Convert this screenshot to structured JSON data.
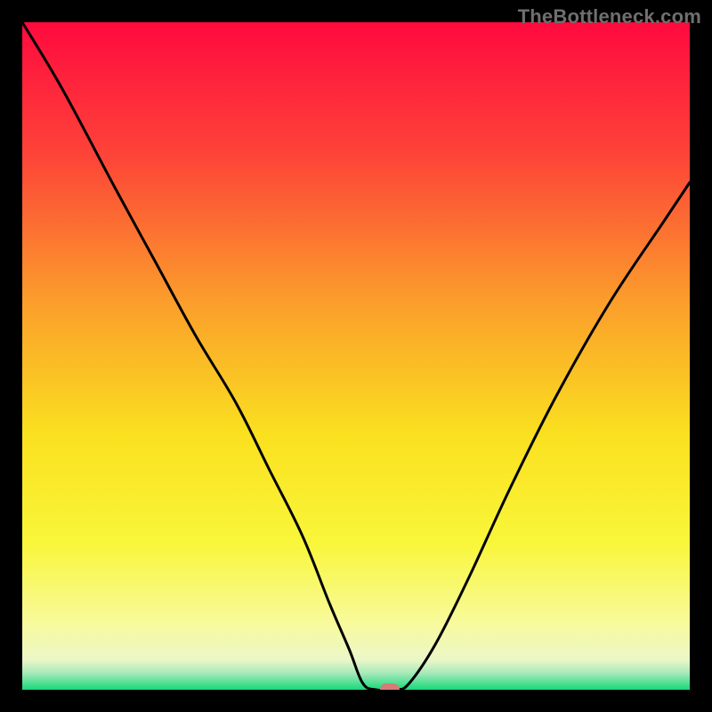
{
  "watermark": "TheBottleneck.com",
  "chart_data": {
    "type": "line",
    "title": "",
    "xlabel": "",
    "ylabel": "",
    "xlim": [
      0,
      100
    ],
    "ylim": [
      0,
      100
    ],
    "grid": false,
    "legend": false,
    "background_gradient": [
      {
        "pos": 0.0,
        "color": "#ff0a3f"
      },
      {
        "pos": 0.2,
        "color": "#fd4438"
      },
      {
        "pos": 0.42,
        "color": "#fb9e2b"
      },
      {
        "pos": 0.62,
        "color": "#fae11f"
      },
      {
        "pos": 0.78,
        "color": "#f9f63a"
      },
      {
        "pos": 0.9,
        "color": "#f8fa9c"
      },
      {
        "pos": 0.955,
        "color": "#ecf7c8"
      },
      {
        "pos": 0.975,
        "color": "#a7e9ba"
      },
      {
        "pos": 1.0,
        "color": "#16d97a"
      }
    ],
    "series": [
      {
        "name": "bottleneck-curve",
        "x": [
          0,
          6,
          14,
          20,
          26,
          32,
          37,
          42,
          46,
          49,
          51,
          53,
          56,
          58,
          62,
          67,
          73,
          80,
          88,
          96,
          100
        ],
        "y": [
          100,
          90,
          75,
          64,
          53,
          43,
          33,
          23,
          13,
          6,
          1,
          0,
          0,
          1,
          7,
          17,
          30,
          44,
          58,
          70,
          76
        ]
      }
    ],
    "marker": {
      "x": 55,
      "y": 0,
      "color": "#d77b77"
    }
  }
}
